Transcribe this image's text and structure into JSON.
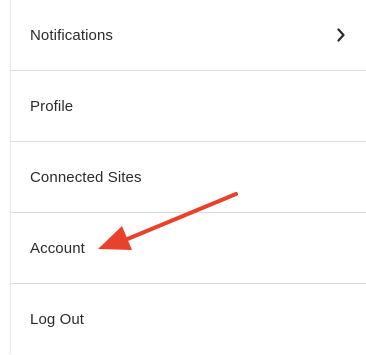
{
  "menu": {
    "items": [
      {
        "label": "Notifications",
        "has_submenu": true,
        "icon": "chevron-right-icon"
      },
      {
        "label": "Profile",
        "has_submenu": false
      },
      {
        "label": "Connected Sites",
        "has_submenu": false
      },
      {
        "label": "Account",
        "has_submenu": false
      },
      {
        "label": "Log Out",
        "has_submenu": false
      }
    ]
  },
  "annotation": {
    "icon": "red-arrow-icon",
    "points_to": "Account",
    "color": "#e8412c"
  },
  "colors": {
    "text": "#2b2b2b",
    "divider": "#dcdcdc",
    "background": "#ffffff"
  }
}
